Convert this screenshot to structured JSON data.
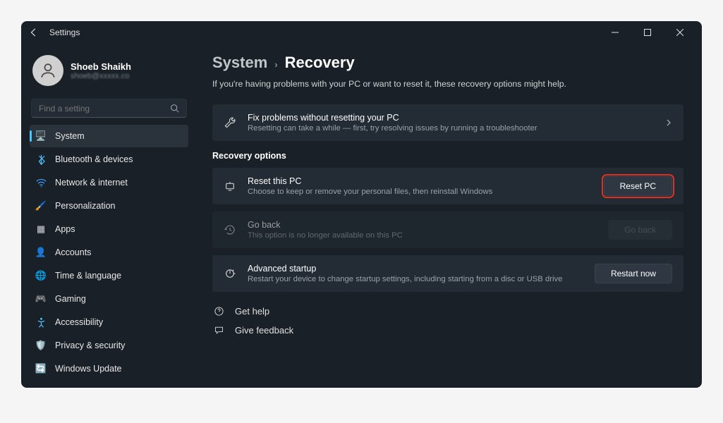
{
  "window": {
    "title": "Settings"
  },
  "profile": {
    "name": "Shoeb Shaikh",
    "email": "shoeb@xxxxx.co"
  },
  "search": {
    "placeholder": "Find a setting"
  },
  "nav": {
    "items": [
      {
        "icon": "🖥️",
        "label": "System",
        "color": "#4cc2ff",
        "active": true
      },
      {
        "icon": "bt",
        "label": "Bluetooth & devices",
        "color": "#4cc2ff"
      },
      {
        "icon": "wifi",
        "label": "Network & internet",
        "color": "#3aa0ff"
      },
      {
        "icon": "🖌️",
        "label": "Personalization",
        "color": "#e07b4a"
      },
      {
        "icon": "▦",
        "label": "Apps",
        "color": "#d0d3d7"
      },
      {
        "icon": "👤",
        "label": "Accounts",
        "color": "#d8b050"
      },
      {
        "icon": "🌐",
        "label": "Time & language",
        "color": "#5ac0d0"
      },
      {
        "icon": "🎮",
        "label": "Gaming",
        "color": "#a090b0"
      },
      {
        "icon": "acc",
        "label": "Accessibility",
        "color": "#4cc2ff"
      },
      {
        "icon": "🛡️",
        "label": "Privacy & security",
        "color": "#a0a6ad"
      },
      {
        "icon": "🔄",
        "label": "Windows Update",
        "color": "#2090e8"
      }
    ]
  },
  "breadcrumb": {
    "parent": "System",
    "current": "Recovery"
  },
  "page": {
    "description": "If you're having problems with your PC or want to reset it, these recovery options might help.",
    "fix": {
      "title": "Fix problems without resetting your PC",
      "subtitle": "Resetting can take a while — first, try resolving issues by running a troubleshooter"
    },
    "section_header": "Recovery options",
    "reset": {
      "title": "Reset this PC",
      "subtitle": "Choose to keep or remove your personal files, then reinstall Windows",
      "button": "Reset PC"
    },
    "goback": {
      "title": "Go back",
      "subtitle": "This option is no longer available on this PC",
      "button": "Go back"
    },
    "advanced": {
      "title": "Advanced startup",
      "subtitle": "Restart your device to change startup settings, including starting from a disc or USB drive",
      "button": "Restart now"
    },
    "help": "Get help",
    "feedback": "Give feedback"
  }
}
